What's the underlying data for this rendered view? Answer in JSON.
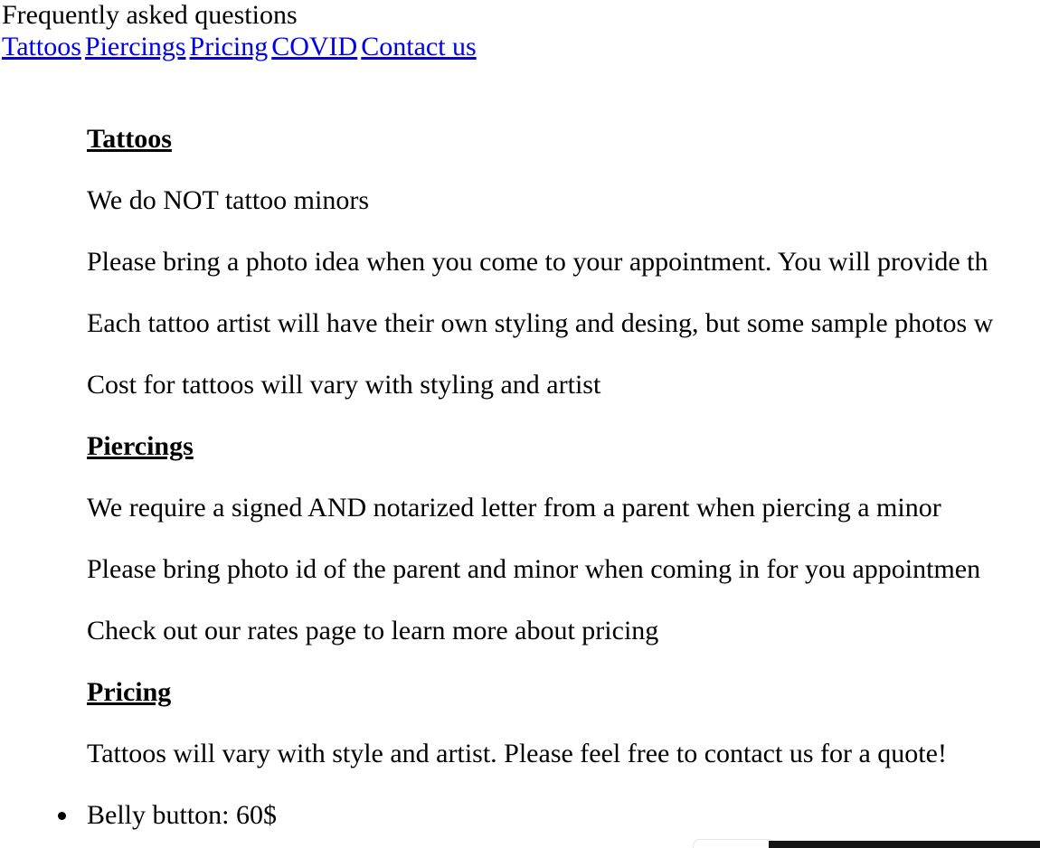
{
  "page_title": "Frequently asked questions",
  "nav": {
    "tattoos": "Tattoos",
    "piercings": "Piercings",
    "pricing": "Pricing",
    "covid": "COVID",
    "contact": "Contact us"
  },
  "sections": {
    "tattoos": {
      "heading": "Tattoos",
      "lines": [
        "We do NOT tattoo minors",
        "Please bring a photo idea when you come to your appointment. You will provide th",
        "Each tattoo artist will have their own styling and desing, but some sample photos w",
        "Cost for tattoos will vary with styling and artist"
      ]
    },
    "piercings": {
      "heading": "Piercings",
      "lines": [
        "We require a signed AND notarized letter from a parent when piercing a minor",
        "Please bring photo id of the parent and minor when coming in for you appointmen",
        "Check out our rates page to learn more about pricing"
      ]
    },
    "pricing": {
      "heading": "Pricing",
      "lines": [
        "Tattoos will vary with style and artist. Please feel free to contact us for a quote!"
      ],
      "list": [
        "Belly button: 60$"
      ]
    }
  }
}
